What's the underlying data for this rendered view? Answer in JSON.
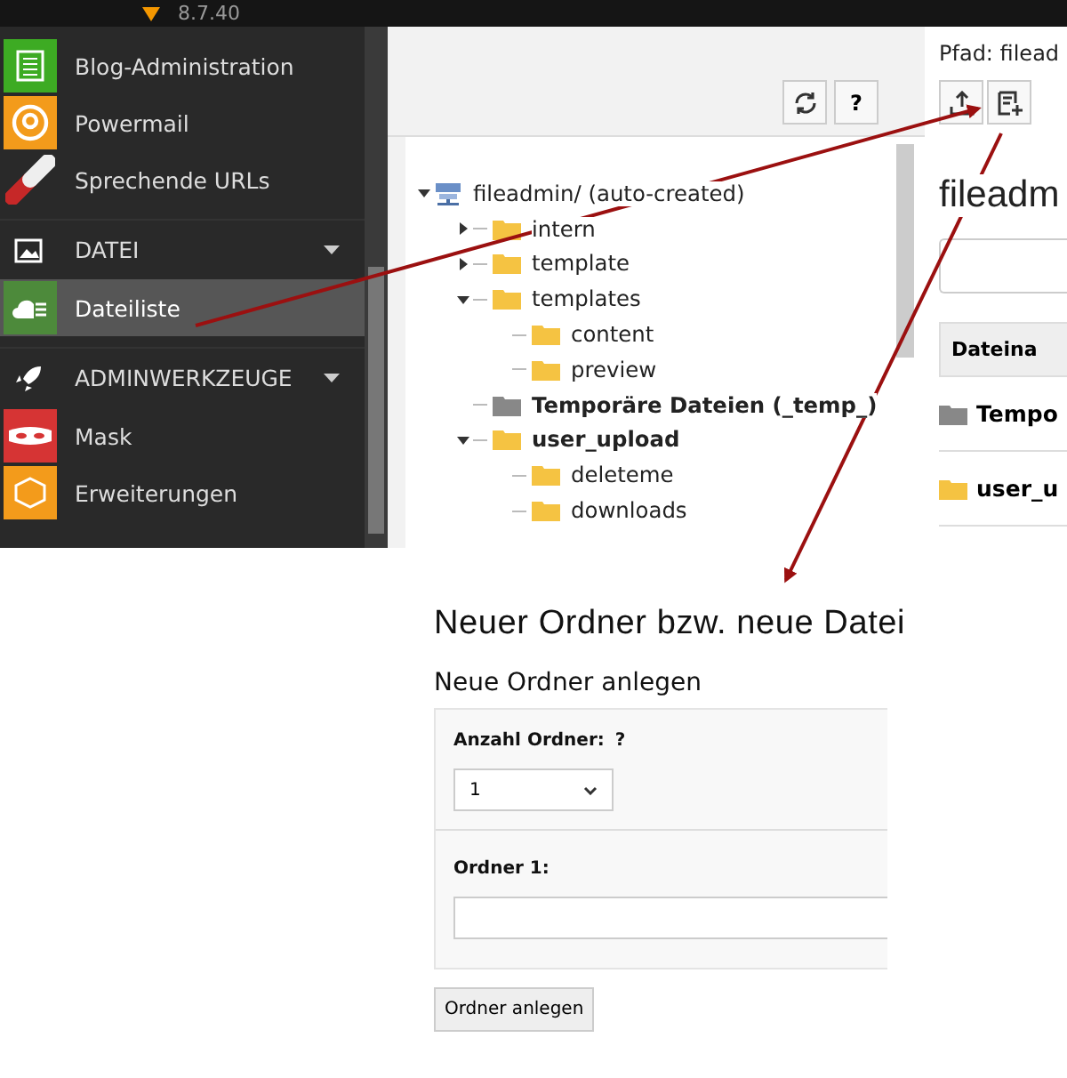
{
  "top_bar": {
    "version": "8.7.40"
  },
  "sidebar": {
    "items": [
      {
        "kind": "module",
        "label": "Blog-Administration",
        "color": "#3dab23",
        "selected": false
      },
      {
        "kind": "module",
        "label": "Powermail",
        "color": "#f39b1b",
        "selected": false
      },
      {
        "kind": "module",
        "label": "Sprechende URLs",
        "selected": false
      },
      {
        "kind": "section",
        "label": "DATEI",
        "expanded": true
      },
      {
        "kind": "module",
        "label": "Dateiliste",
        "color": "#4d8a3b",
        "selected": true
      },
      {
        "kind": "section",
        "label": "ADMINWERKZEUGE",
        "expanded": true
      },
      {
        "kind": "module",
        "label": "Mask",
        "color": "#d63434",
        "selected": false
      },
      {
        "kind": "module",
        "label": "Erweiterungen",
        "color": "#f39b1b",
        "selected": false
      }
    ]
  },
  "tree_toolbar": {
    "buttons": [
      {
        "kind": "refresh"
      },
      {
        "kind": "help",
        "label": "?"
      }
    ]
  },
  "tree": [
    {
      "label": "fileadmin/ (auto-created)",
      "kind": "storage",
      "bold": false,
      "expanded": true,
      "children": [
        {
          "label": "intern",
          "kind": "folder",
          "bold": false,
          "expanded": false
        },
        {
          "label": "template",
          "kind": "folder",
          "bold": false,
          "expanded": false
        },
        {
          "label": "templates",
          "kind": "folder",
          "bold": false,
          "expanded": true,
          "children": [
            {
              "label": "content",
              "kind": "folder",
              "bold": false
            },
            {
              "label": "preview",
              "kind": "folder",
              "bold": false
            }
          ]
        },
        {
          "label": "Temporäre Dateien (_temp_)",
          "kind": "temp",
          "bold": true
        },
        {
          "label": "user_upload",
          "kind": "folder",
          "bold": true,
          "expanded": true,
          "children": [
            {
              "label": "deleteme",
              "kind": "folder",
              "bold": false
            },
            {
              "label": "downloads",
              "kind": "folder",
              "bold": false
            }
          ]
        }
      ]
    }
  ],
  "content": {
    "path": "Pfad: filead",
    "toolbar": [
      {
        "kind": "upload"
      },
      {
        "kind": "new-file"
      }
    ],
    "heading": "fileadm",
    "table": {
      "columns": [
        "Dateina"
      ],
      "rows": [
        {
          "kind": "temp",
          "name": "Tempo"
        },
        {
          "kind": "folder",
          "name": "user_u"
        }
      ]
    }
  },
  "dialog": {
    "title": "Neuer Ordner bzw. neue Datei",
    "subtitle": "Neue Ordner anlegen",
    "count_label": "Anzahl Ordner:",
    "help": "?",
    "count_value": "1",
    "folder_label": "Ordner 1:",
    "submit": "Ordner anlegen"
  }
}
